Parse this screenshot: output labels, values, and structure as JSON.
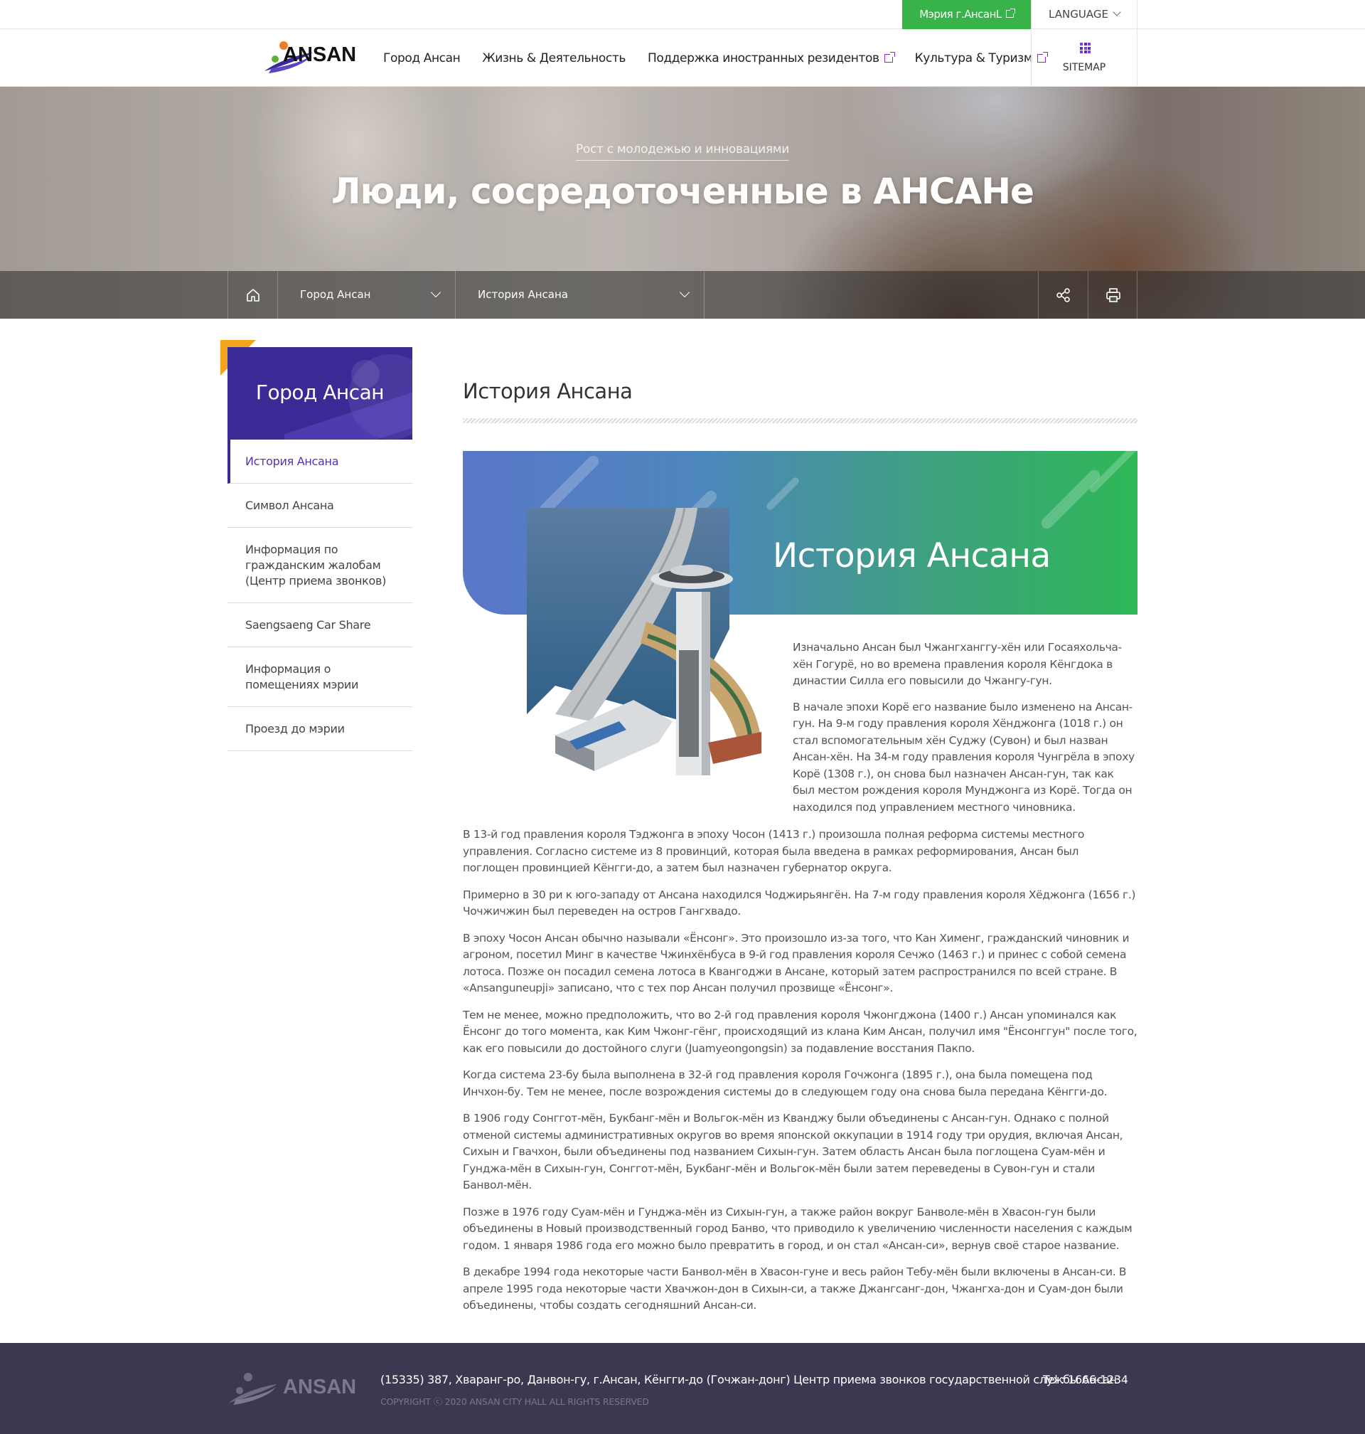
{
  "utility": {
    "mayor_link": "Мэрия г.АнсанL",
    "language": "LANGUAGE"
  },
  "header": {
    "logo_text": "ANSAN",
    "nav": [
      {
        "label": "Город Ансан",
        "external": false
      },
      {
        "label": "Жизнь & Деятельность",
        "external": false
      },
      {
        "label": "Поддержка иностранных резидентов",
        "external": true
      },
      {
        "label": "Культура & Туризм",
        "external": true
      }
    ],
    "sitemap": "SITEMAP"
  },
  "hero": {
    "subtitle": "Рост с молодежью и инновациями",
    "title": "Люди, сосредоточенные в АНСАНе"
  },
  "location": {
    "level1": "Город Ансан",
    "level2": "История Ансана",
    "icons": [
      "home-icon",
      "chevron-down-icon",
      "share-icon",
      "print-icon"
    ]
  },
  "sidebar": {
    "title": "Город Ансан",
    "items": [
      {
        "label": "История Ансана",
        "active": true
      },
      {
        "label": "Символ Ансана",
        "active": false
      },
      {
        "label": "Информация по гражданским жалобам (Центр приема звонков)",
        "active": false
      },
      {
        "label": "Saengsaeng Car Share",
        "active": false
      },
      {
        "label": "Информация о помещениях мэрии",
        "active": false
      },
      {
        "label": "Проезд до мэрии",
        "active": false
      }
    ]
  },
  "content": {
    "page_title": "История Ансана",
    "banner_title": "История Ансана",
    "intro": [
      "Изначально Ансан был Чжангханггу-хён или Госаяхольча-хён Гогурё, но во времена правления короля Кёнгдока в династии Силла его повысили до Чжангу-гун.",
      "В начале эпохи Корё его название было изменено на Ансан-гун. На 9-м году правления короля Хёнджонга (1018 г.) он стал вспомогательным хён Суджу (Сувон) и был назван Ансан-хён. На 34-м году правления короля Чунгрёла в эпоху Корё (1308 г.), он снова был назначен Ансан-гун, так как был местом рождения короля Мунджонга из Корё. Тогда он находился под управлением местного чиновника."
    ],
    "paragraphs": [
      "В 13-й год правления короля Тэджонга в эпоху Чосон (1413 г.) произошла полная реформа системы местного управления. Согласно системе из 8 провинций, которая была введена в рамках реформирования, Ансан был поглощен провинцией Кёнгги-до, а затем был назначен губернатор округа.",
      "Примерно в 30 ри к юго-западу от Ансана находился Чоджирьянгён. На 7-м году правления короля Хёджонга (1656 г.) Чочжичжин был переведен на остров Гангхвадо.",
      "В эпоху Чосон Ансан обычно называли «Ёнсонг». Это произошло из-за того, что Кан Хименг, гражданский чиновник и агроном, посетил Минг в качестве Чжинхёнбуса в 9-й год правления короля Сечжо (1463 г.) и принес с собой семена лотоса. Позже он посадил семена лотоса в Квангоджи в Ансане, который затем распространился по всей стране. В «Ansanguneupji» записано, что с тех пор Ансан получил прозвище «Ёнсонг».",
      "Тем не менее, можно предположить, что во 2-й год правления короля Чжонгджона (1400 г.) Ансан упоминался как Ёнсонг до того момента, как Ким Чжонг-гёнг, происходящий из клана Ким Ансан, получил имя \"Ёнсонггун\" после того, как его повысили до достойного слуги (Juamyeongongsin) за подавление восстания Пакпо.",
      "Когда система 23-бу была выполнена в 32-й год правления короля Гочжонга (1895 г.), она была помещена под Инчхон-бу. Тем не менее, после возрождения системы до в следующем году она снова была передана Кёнгги-до.",
      "В 1906 году Сонггот-мён, Букбанг-мён и Вольгок-мён из Кванджу были объединены с Ансан-гун. Однако с полной отменой системы административных округов во время японской оккупации в 1914 году три орудия, включая Ансан, Сихын и Гвачхон, были объединены под названием Сихын-гун. Затем область Ансан была поглощена Суам-мён и Гунджа-мён в Сихын-гун, Сонггот-мён, Букбанг-мён и Вольгок-мён были затем переведены в Сувон-гун и стали Банвол-мён.",
      "Позже в 1976 году Суам-мён и Гунджа-мён из Сихын-гун, а также район вокруг Банволе-мён в Хвасон-гун были объединены в Новый производственный город Банво, что приводило к увеличению численности населения с каждым годом. 1 января 1986 года его можно было превратить в город, и он стал «Ансан-си», вернув своё старое название.",
      "В декабре 1994 года некоторые части Банвол-мён в Хвасон-гуне и весь район Тебу-мён были включены в Ансан-си. В апреле 1995 года некоторые части Хвачжон-дон в Сихын-си, а также Джангсанг-дон, Чжангха-дон и Суам-дон были объединены, чтобы создать сегодняшний Ансан-си."
    ]
  },
  "footer": {
    "logo_text": "ANSAN",
    "address": "(15335) 387, Хваранг-ро, Данвон-гу, г.Ансан, Кёнгги-до (Гочжан-донг) Центр приема звонков государственной службы Ансан",
    "tel": "Tel : 1666-1234",
    "copyright": "COPYRIGHT ⓒ 2020 ANSAN CITY HALL ALL RIGHTS RESERVED"
  },
  "colors": {
    "brand_purple": "#3a2a96",
    "mayor_green": "#37b34a",
    "accent_orange": "#f5a21c",
    "footer_bg": "#3d3851"
  }
}
